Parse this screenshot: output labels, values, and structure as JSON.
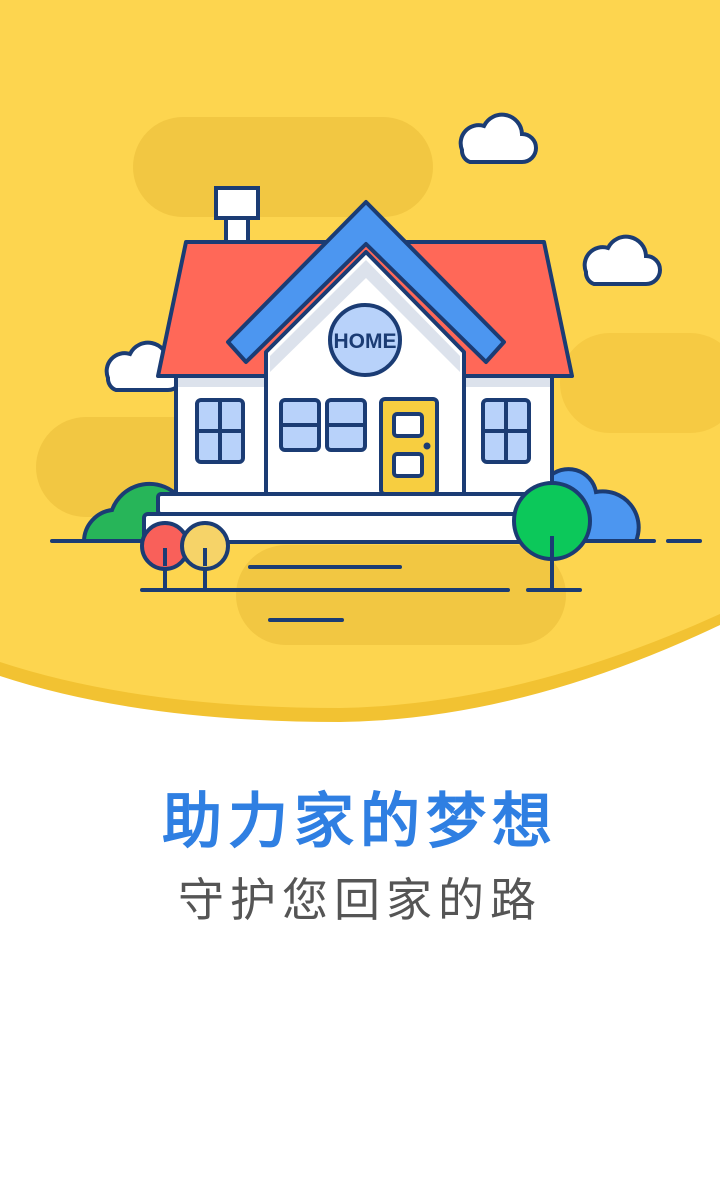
{
  "splash": {
    "house_sign": "HOME",
    "title": "助力家的梦想",
    "subtitle": "守护您回家的路"
  },
  "colors": {
    "background_yellow": "#FDD54F",
    "wave_yellow": "#F2C232",
    "roof_red": "#FF6858",
    "roof_trim_blue": "#4C96F0",
    "outline_navy": "#1B3C74",
    "window_blue": "#B8D2FA",
    "door_yellow": "#F7CE40",
    "tree_green": "#0CC85A",
    "bush_green": "#27B559",
    "bush_blue": "#4C96F0",
    "small_tree_red": "#F9605A",
    "small_tree_yellow": "#F6D368",
    "title_blue": "#2F7FE2",
    "subtitle_gray": "#555555"
  }
}
